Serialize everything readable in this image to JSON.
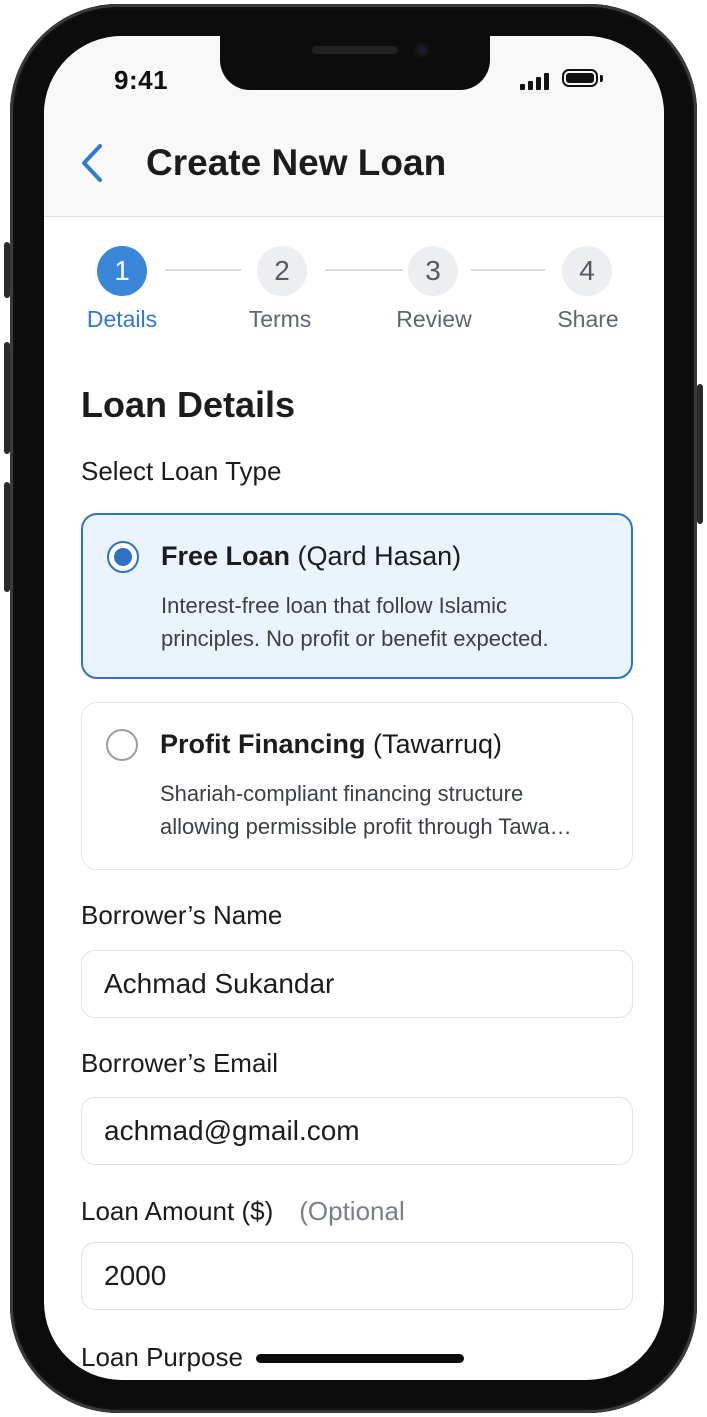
{
  "status_bar": {
    "time": "9:41"
  },
  "header": {
    "title": "Create New Loan"
  },
  "stepper": {
    "steps": [
      {
        "number": "1",
        "label": "Details",
        "active": true
      },
      {
        "number": "2",
        "label": "Terms",
        "active": false
      },
      {
        "number": "3",
        "label": "Review",
        "active": false
      },
      {
        "number": "4",
        "label": "Share",
        "active": false
      }
    ]
  },
  "form": {
    "section_title": "Loan Details",
    "loan_type_label": "Select Loan Type",
    "loan_types": [
      {
        "title": "Free Loan",
        "subtitle": "(Qard Hasan)",
        "description_line1": "Interest-free loan that follow Islamic",
        "description_line2": "principles. No profit or benefit expected.",
        "selected": true
      },
      {
        "title": "Profit Financing",
        "subtitle": "(Tawarruq)",
        "description_line1": "Shariah-compliant financing structure",
        "description_line2": "allowing permissible profit through Tawa…",
        "selected": false
      }
    ],
    "borrower_name": {
      "label": "Borrower’s Name",
      "value": "Achmad Sukandar"
    },
    "borrower_email": {
      "label": "Borrower’s Email",
      "value": "achmad@gmail.com"
    },
    "loan_amount": {
      "label": "Loan Amount ($)",
      "optional_label": "(Optional",
      "value": "2000"
    },
    "loan_purpose": {
      "label": "Loan Purpose"
    }
  },
  "colors": {
    "accent": "#2f72c4",
    "step_active": "#3a86d8",
    "selected_card_bg": "#ebf3fd"
  },
  "icons": [
    "back-chevron-icon",
    "signal-icon",
    "battery-icon",
    "radio-checked-icon",
    "radio-unchecked-icon"
  ]
}
